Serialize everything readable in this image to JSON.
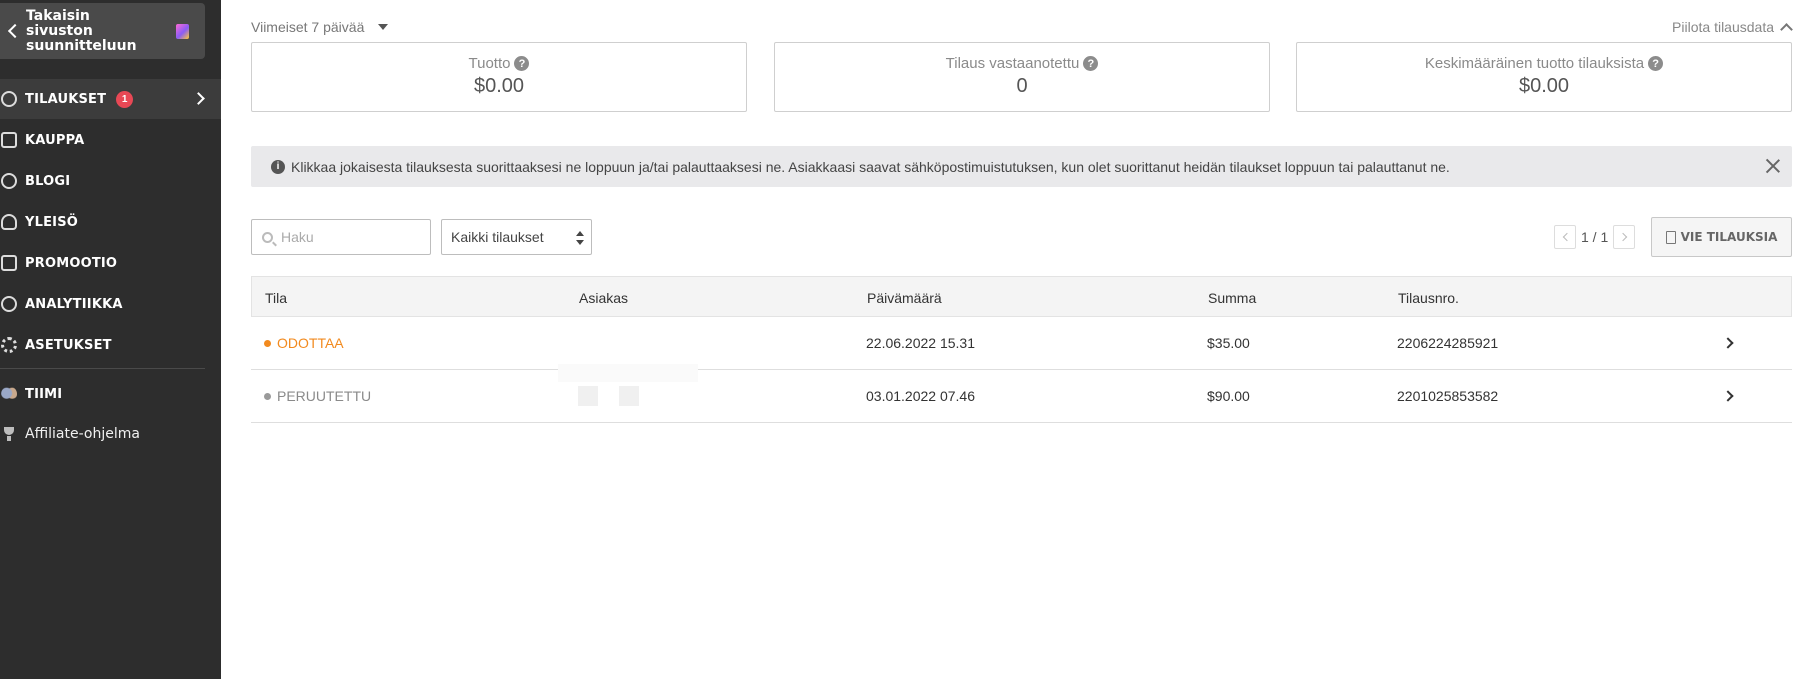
{
  "sidebar": {
    "back_label": "Takaisin sivuston suunnitteluun",
    "items": [
      {
        "label": "TILAUKSET",
        "icon": "dollar-icon",
        "badge": "1"
      },
      {
        "label": "KAUPPA",
        "icon": "store-icon"
      },
      {
        "label": "BLOGI",
        "icon": "quill-icon"
      },
      {
        "label": "YLEISÖ",
        "icon": "audience-icon"
      },
      {
        "label": "PROMOOTIO",
        "icon": "megaphone-icon"
      },
      {
        "label": "ANALYTIIKKA",
        "icon": "pie-chart-icon"
      },
      {
        "label": "ASETUKSET",
        "icon": "gear-icon"
      },
      {
        "label": "TIIMI",
        "icon": "team-avatars-icon"
      },
      {
        "label": "Affiliate-ohjelma",
        "icon": "trophy-icon"
      }
    ]
  },
  "header": {
    "period": "Viimeiset 7 päivää",
    "hide_data": "Piilota tilausdata"
  },
  "stats": [
    {
      "label": "Tuotto",
      "value": "$0.00"
    },
    {
      "label": "Tilaus vastaanotettu",
      "value": "0"
    },
    {
      "label": "Keskimääräinen tuotto tilauksista",
      "value": "$0.00"
    }
  ],
  "info_banner": {
    "message": "Klikkaa jokaisesta tilauksesta suorittaaksesi ne loppuun ja/tai palauttaaksesi ne. Asiakkaasi saavat sähköpostimuistutuksen, kun olet suorittanut heidän tilaukset loppuun tai palauttanut ne."
  },
  "toolbar": {
    "search_placeholder": "Haku",
    "filter_selected": "Kaikki tilaukset",
    "pager_text": "1 / 1",
    "export_label": "VIE TILAUKSIA"
  },
  "table": {
    "columns": [
      "Tila",
      "Asiakas",
      "Päivämäärä",
      "Summa",
      "Tilausnro."
    ],
    "rows": [
      {
        "status": "ODOTTAA",
        "customer": "",
        "date": "22.06.2022 15.31",
        "sum": "$35.00",
        "order_no": "2206224285921"
      },
      {
        "status": "PERUUTETTU",
        "customer": "",
        "date": "03.01.2022 07.46",
        "sum": "$90.00",
        "order_no": "2201025853582"
      }
    ]
  },
  "colors": {
    "sidebar_bg": "#2d2d2d",
    "pending": "#f28a1e",
    "cancelled": "#8a8a8a",
    "badge": "#e84855"
  }
}
